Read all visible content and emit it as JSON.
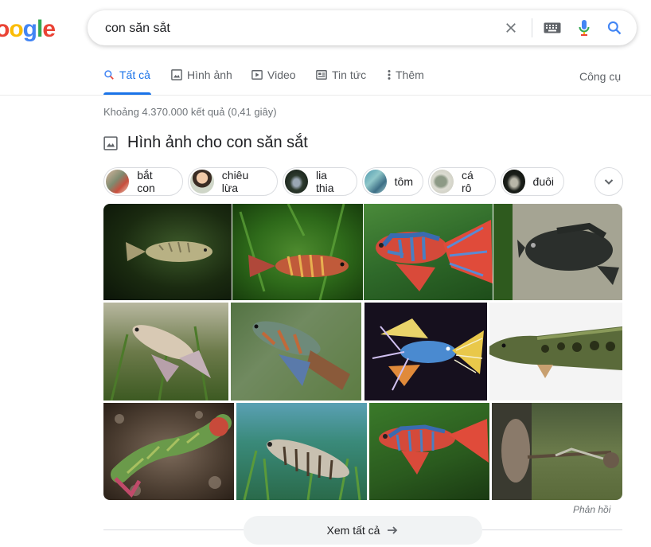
{
  "logo": {
    "part1": "o",
    "part2": "o",
    "part3": "g",
    "part4": "l",
    "part5": "e"
  },
  "search": {
    "query": "con săn sắt"
  },
  "tabs": [
    {
      "label": "Tất cả",
      "icon": "search-icon"
    },
    {
      "label": "Hình ảnh",
      "icon": "image-icon"
    },
    {
      "label": "Video",
      "icon": "video-icon"
    },
    {
      "label": "Tin tức",
      "icon": "news-icon"
    },
    {
      "label": "Thêm",
      "icon": "more-vert-icon"
    }
  ],
  "tools_label": "Công cụ",
  "result_stats": "Khoảng 4.370.000 kết quả (0,41 giây)",
  "images_section": {
    "title": "Hình ảnh cho con săn sắt"
  },
  "chips": [
    {
      "label": "bắt con"
    },
    {
      "label": "chiêu lừa"
    },
    {
      "label": "lia thia"
    },
    {
      "label": "tôm"
    },
    {
      "label": "cá rô"
    },
    {
      "label": "đuôi"
    }
  ],
  "feedback": "Phản hồi",
  "see_all": "Xem tất cả",
  "colors": {
    "accent": "#1a73e8",
    "text": "#202124",
    "muted": "#70757a"
  }
}
